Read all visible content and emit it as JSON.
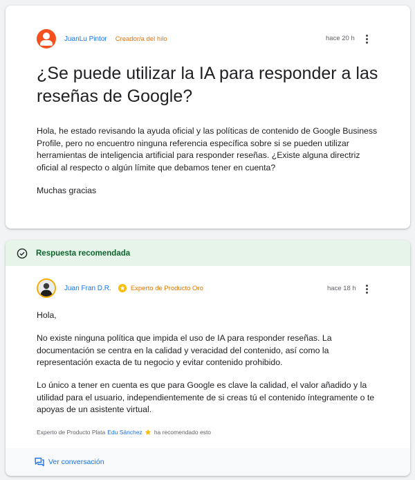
{
  "question": {
    "author_name": "JuanLu Pintor",
    "author_role": "Creador/a del hilo",
    "time": "hace 20 h",
    "title": "¿Se puede utilizar la IA para responder a las reseñas de Google?",
    "body": "Hola, he estado revisando la ayuda oficial y las políticas de contenido de Google Business Profile, pero no encuentro ninguna referencia específica sobre si se pueden utilizar herramientas de inteligencia artificial para responder reseñas. ¿Existe alguna directriz oficial al respecto o algún límite que debamos tener en cuenta?",
    "closing": "Muchas gracias"
  },
  "answer": {
    "banner_label": "Respuesta recomendada",
    "author_name": "Juan Fran D.R.",
    "author_role": "Experto de Producto Oro",
    "time": "hace 18 h",
    "greeting": "Hola,",
    "paragraph_1": "No existe ninguna política que impida el uso de IA para responder reseñas. La documentación se centra en la calidad y veracidad del contenido, así como la representación exacta de tu negocio y evitar contenido prohibido.",
    "paragraph_2": "Lo único a tener en cuenta es que para Google es clave la calidad, el valor añadido y la utilidad para el usuario, independientemente de si creas tú el contenido íntegramente o te apoyas de un asistente virtual.",
    "recommended_by_prefix": "Experto de Producto Plata",
    "recommended_by_name": "Edu Sánchez",
    "recommended_by_suffix": "ha recomendado esto",
    "view_conversation": "Ver conversación"
  },
  "colors": {
    "link_blue": "#1a73e8",
    "orange_role": "#e8710a",
    "gold_role": "#e37400",
    "banner_bg": "#e6f4ea",
    "banner_text": "#0d652d"
  },
  "icons": {
    "question_avatar": "person-icon",
    "menu": "more-vert-icon",
    "banner": "check-circle-icon",
    "gold_badge": "star-badge-icon",
    "silver_badge": "star-badge-icon",
    "footer": "forum-icon"
  }
}
